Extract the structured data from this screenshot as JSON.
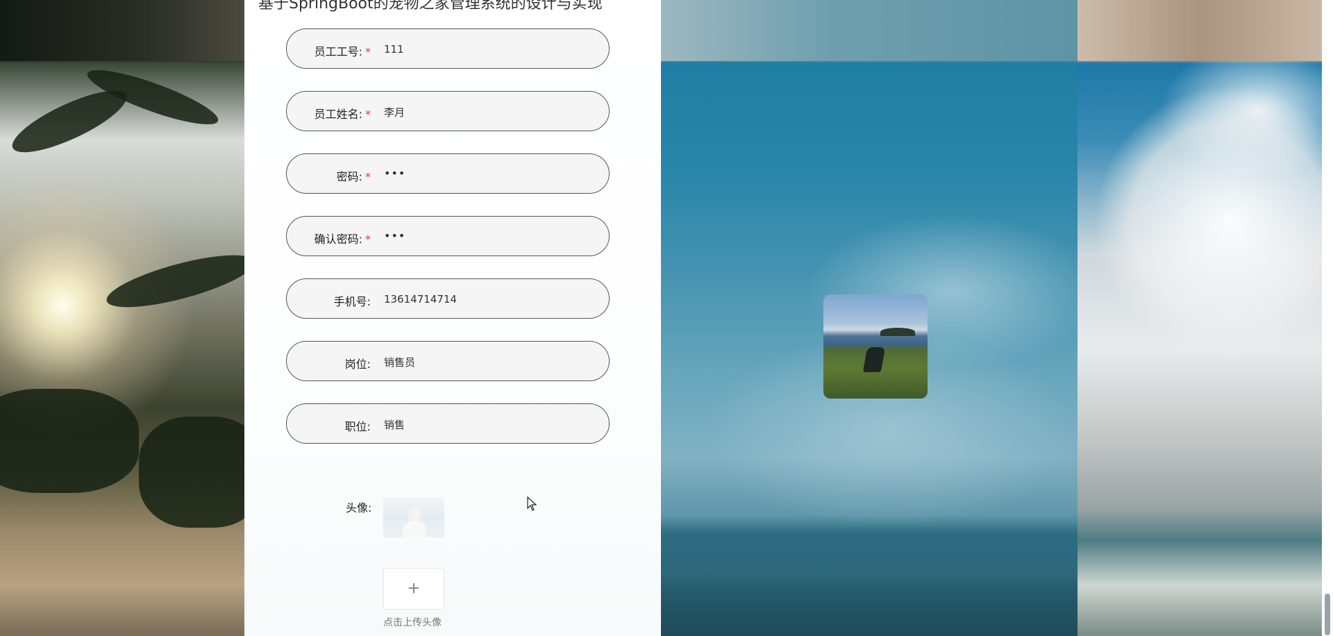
{
  "page": {
    "title": "基于SpringBoot的宠物之家管理系统的设计与实现"
  },
  "form": {
    "fields": [
      {
        "label": "员工工号:",
        "required": true,
        "value": "111",
        "type": "text"
      },
      {
        "label": "员工姓名:",
        "required": true,
        "value": "李月",
        "type": "text"
      },
      {
        "label": "密码:",
        "required": true,
        "value": "•••",
        "type": "password"
      },
      {
        "label": "确认密码:",
        "required": true,
        "value": "•••",
        "type": "password"
      },
      {
        "label": "手机号:",
        "required": false,
        "value": "13614714714",
        "type": "text"
      },
      {
        "label": "岗位:",
        "required": false,
        "value": "销售员",
        "type": "text"
      },
      {
        "label": "职位:",
        "required": false,
        "value": "销售",
        "type": "text"
      }
    ],
    "required_mark": "*",
    "avatar": {
      "label": "头像:",
      "upload_icon": "plus-icon",
      "upload_glyph": "+",
      "upload_hint": "点击上传头像"
    }
  },
  "colors": {
    "required": "#e53935",
    "field_border": "#555555",
    "field_bg": "#f5f5f5"
  }
}
